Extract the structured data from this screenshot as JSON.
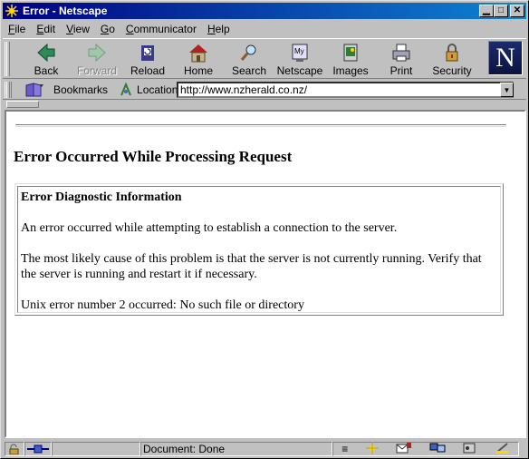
{
  "window": {
    "title": "Error - Netscape"
  },
  "menu": [
    {
      "key": "F",
      "rest": "ile"
    },
    {
      "key": "E",
      "rest": "dit"
    },
    {
      "key": "V",
      "rest": "iew"
    },
    {
      "key": "G",
      "rest": "o"
    },
    {
      "key": "C",
      "rest": "ommunicator"
    },
    {
      "key": "H",
      "rest": "elp"
    }
  ],
  "toolbar": {
    "back": "Back",
    "forward": "Forward",
    "reload": "Reload",
    "home": "Home",
    "search": "Search",
    "netscape": "Netscape",
    "images": "Images",
    "print": "Print",
    "security": "Security",
    "logo": "N"
  },
  "location": {
    "bookmarks_label": "Bookmarks",
    "location_label": "Location:",
    "url": "http://www.nzherald.co.nz/"
  },
  "page": {
    "heading": "Error Occurred While Processing Request",
    "diag_title": "Error Diagnostic Information",
    "p1": "An error occurred while attempting to establish a connection to the server.",
    "p2": "The most likely cause of this problem is that the server is not currently running. Verify that the server is running and restart it if necessary.",
    "p3": "Unix error number 2 occurred: No such file or directory"
  },
  "status": {
    "text": "Document: Done"
  },
  "colors": {
    "titlebar_start": "#000080",
    "titlebar_end": "#1084d0",
    "chrome": "#c0c0c0"
  }
}
